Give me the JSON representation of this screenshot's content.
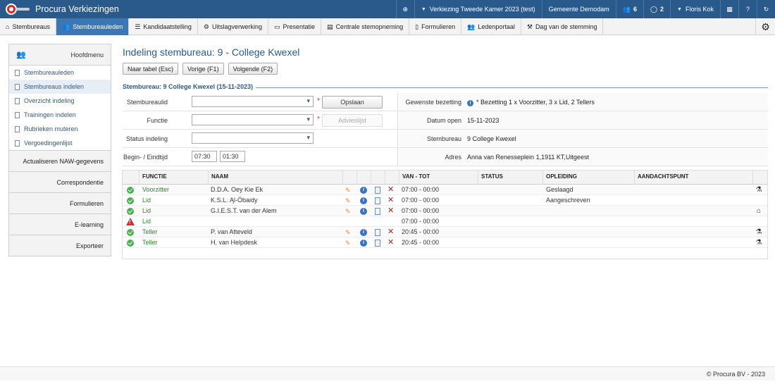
{
  "topbar": {
    "app_title": "Procura Verkiezingen",
    "election": "Verkiezing Tweede Kamer 2023 (test)",
    "municipality": "Gemeente Demodam",
    "people_count": "6",
    "message_count": "2",
    "user": "Floris Kok",
    "help": "?"
  },
  "nav": {
    "tabs": [
      {
        "label": "Stembureaus"
      },
      {
        "label": "Stembureauleden"
      },
      {
        "label": "Kandidaatstelling"
      },
      {
        "label": "Uitslagverwerking"
      },
      {
        "label": "Presentatie"
      },
      {
        "label": "Centrale stemopneming"
      },
      {
        "label": "Formulieren"
      },
      {
        "label": "Ledenportaal"
      },
      {
        "label": "Dag van de stemming"
      }
    ]
  },
  "sidebar": {
    "header": "Hoofdmenu",
    "items": [
      {
        "label": "Stembureauleden"
      },
      {
        "label": "Stembureaus indelen"
      },
      {
        "label": "Overzicht indeling"
      },
      {
        "label": "Trainingen indelen"
      },
      {
        "label": "Rubrieken muteren"
      },
      {
        "label": "Vergoedingenlijst"
      }
    ],
    "sections": [
      {
        "label": "Actualiseren NAW-gegevens"
      },
      {
        "label": "Correspondentie"
      },
      {
        "label": "Formulieren"
      },
      {
        "label": "E-learning"
      },
      {
        "label": "Exporteer"
      }
    ]
  },
  "main": {
    "title": "Indeling stembureau: 9 - College Kwexel",
    "buttons": {
      "back": "Naar tabel (Esc)",
      "prev": "Vorige (F1)",
      "next": "Volgende (F2)"
    },
    "legend": "Stembureau: 9 College Kwexel (15-11-2023)"
  },
  "form": {
    "stembureaulid_label": "Stembureaulid",
    "functie_label": "Functie",
    "status_label": "Status indeling",
    "time_label": "Begin- / Eindtijd",
    "begin_time": "07:30",
    "end_time": "01:30",
    "save_button": "Opslaan",
    "advice_button": "Advieslijst",
    "required_mark": "*"
  },
  "info": {
    "bezetting_label": "Gewenste bezetting",
    "bezetting_value": "* Bezetting 1 x Voorzitter, 3 x Lid, 2 Tellers",
    "datum_label": "Datum open",
    "datum_value": "15-11-2023",
    "stembureau_label": "Stembureau",
    "stembureau_value": "9 College Kwexel",
    "adres_label": "Adres",
    "adres_value": "Anna van Renesseplein 1,1911 KT,Uitgeest"
  },
  "table": {
    "headers": {
      "functie": "FUNCTIE",
      "naam": "NAAM",
      "tijd": "VAN - TOT",
      "status": "STATUS",
      "opleiding": "OPLEIDING",
      "aandacht": "AANDACHTSPUNT"
    },
    "rows": [
      {
        "functie": "Voorzitter",
        "naam": "D.D.A. Oey Kie Ek",
        "tijd": "07:00 - 00:00",
        "opleiding": "Geslaagd"
      },
      {
        "functie": "Lid",
        "naam": "K.S.L. Ąl-Öbaidy",
        "tijd": "07:00 - 00:00",
        "opleiding": "Aangeschreven"
      },
      {
        "functie": "Lid",
        "naam": "G.I.E.S.T. van der Alem",
        "tijd": "07:00 - 00:00",
        "opleiding": ""
      },
      {
        "functie": "Lid",
        "naam": "",
        "tijd": "07:00 - 00:00",
        "opleiding": ""
      },
      {
        "functie": "Teller",
        "naam": "P. van Atteveld",
        "tijd": "20:45 - 00:00",
        "opleiding": ""
      },
      {
        "functie": "Teller",
        "naam": "H. van Helpdesk",
        "tijd": "20:45 - 00:00",
        "opleiding": ""
      }
    ]
  },
  "footer": {
    "copyright": "© Procura BV - 2023"
  }
}
